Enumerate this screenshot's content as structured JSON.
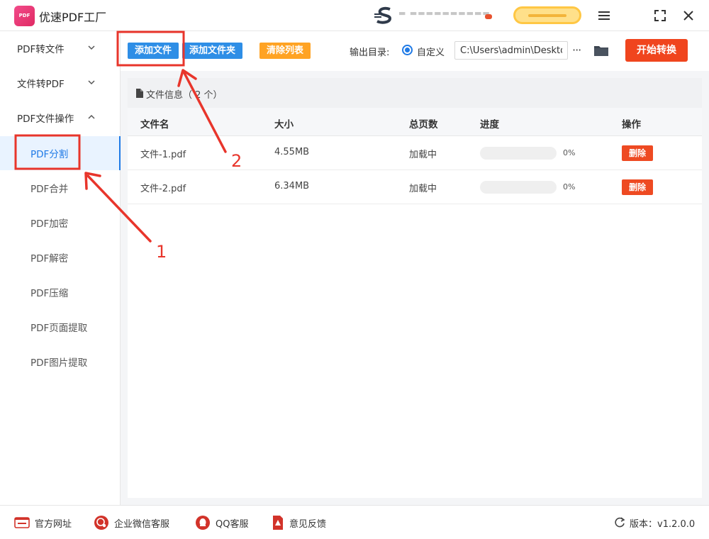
{
  "app": {
    "title": "优速PDF工厂",
    "logo_text": "PDF"
  },
  "sidebar": {
    "groups": [
      {
        "label": "PDF转文件"
      },
      {
        "label": "文件转PDF"
      },
      {
        "label": "PDF文件操作"
      }
    ],
    "items": [
      {
        "label": "PDF分割",
        "active": true
      },
      {
        "label": "PDF合并"
      },
      {
        "label": "PDF加密"
      },
      {
        "label": "PDF解密"
      },
      {
        "label": "PDF压缩"
      },
      {
        "label": "PDF页面提取"
      },
      {
        "label": "PDF图片提取"
      }
    ]
  },
  "toolbar": {
    "add_file": "添加文件",
    "add_folder": "添加文件夹",
    "clear_list": "清除列表",
    "output_label": "输出目录:",
    "custom_label": "自定义",
    "output_path": "C:\\Users\\admin\\Deskto",
    "start": "开始转换"
  },
  "file_panel": {
    "title": "文件信息（ 2 个）",
    "columns": [
      "文件名",
      "大小",
      "总页数",
      "进度",
      "操作"
    ],
    "rows": [
      {
        "name": "文件-1.pdf",
        "size": "4.55MB",
        "pages": "加载中",
        "progress": "0%",
        "action": "删除"
      },
      {
        "name": "文件-2.pdf",
        "size": "6.34MB",
        "pages": "加载中",
        "progress": "0%",
        "action": "删除"
      }
    ]
  },
  "footer": {
    "website": "官方网址",
    "wechat": "企业微信客服",
    "qq": "QQ客服",
    "feedback": "意见反馈",
    "version": "版本：v1.2.0.0"
  },
  "annotations": {
    "step1": "1",
    "step2": "2",
    "color": "#e8352b"
  },
  "colors": {
    "primary": "#2e8ee6",
    "clear": "#ffa323",
    "start": "#f0451e",
    "delete": "#ee4a22"
  }
}
